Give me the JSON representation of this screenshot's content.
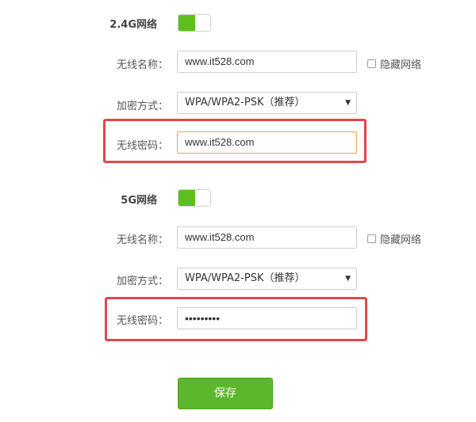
{
  "band24": {
    "title": "2.4G网络",
    "enabled": true,
    "ssid_label": "无线名称：",
    "ssid_value": "www.it528.com",
    "hide_label": "隐藏网络",
    "hide_checked": false,
    "security_label": "加密方式：",
    "security_value": "WPA/WPA2-PSK（推荐）",
    "password_label": "无线密码：",
    "password_value": "www.it528.com"
  },
  "band5": {
    "title": "5G网络",
    "enabled": true,
    "ssid_label": "无线名称：",
    "ssid_value": "www.it528.com",
    "hide_label": "隐藏网络",
    "hide_checked": false,
    "security_label": "加密方式：",
    "security_value": "WPA/WPA2-PSK（推荐）",
    "password_label": "无线密码：",
    "password_value": "•••••••••"
  },
  "save_label": "保存",
  "colors": {
    "accent_green": "#5cb82a",
    "toggle_green": "#5cbf1e",
    "highlight_red": "#e0474c",
    "focus_orange": "#f0a050"
  }
}
